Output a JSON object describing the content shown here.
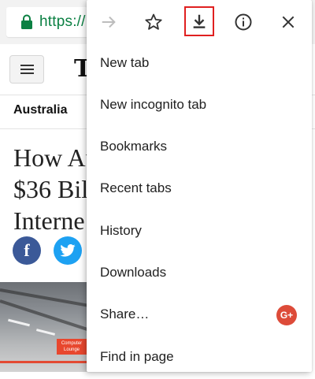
{
  "browser": {
    "url_text": "https://",
    "url_color": "#0b8043"
  },
  "page": {
    "logo": "T",
    "section": "Australia",
    "headline_lines": [
      "How Au",
      "$36 Bil",
      "Interne"
    ],
    "image_sign": "Computer Lounge",
    "social_icons": [
      "facebook-icon",
      "twitter-icon"
    ]
  },
  "menu": {
    "toolbar_icons": [
      "forward-arrow-icon",
      "star-icon",
      "download-icon",
      "info-icon",
      "close-icon"
    ],
    "highlight_color": "#e02020",
    "items": [
      {
        "label": "New tab"
      },
      {
        "label": "New incognito tab"
      },
      {
        "label": "Bookmarks"
      },
      {
        "label": "Recent tabs"
      },
      {
        "label": "History"
      },
      {
        "label": "Downloads"
      },
      {
        "label": "Share…",
        "icon": "google-plus-icon",
        "icon_text": "G+"
      },
      {
        "label": "Find in page"
      }
    ]
  }
}
